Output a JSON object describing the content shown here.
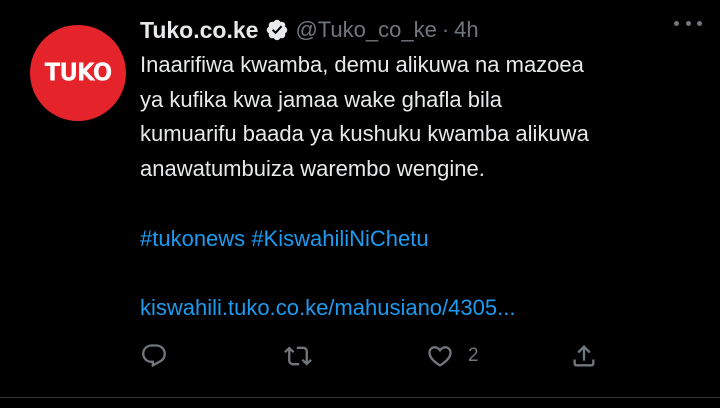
{
  "tweet": {
    "avatar_text": "TUKO",
    "display_name": "Tuko.co.ke",
    "handle": "@Tuko_co_ke",
    "separator": "·",
    "time": "4h",
    "body_lines": [
      "Inaarifiwa kwamba, demu alikuwa na mazoea",
      "ya kufika kwa jamaa wake ghafla bila",
      "kumuarifu baada ya kushuku kwamba alikuwa",
      "anawatumbuiza warembo wengine."
    ],
    "hashtags": [
      "#tukonews",
      "#KiswahiliNiChetu"
    ],
    "link": "kiswahili.tuko.co.ke/mahusiano/4305...",
    "actions": {
      "reply_count": "",
      "retweet_count": "",
      "like_count": "2"
    }
  },
  "icons": {
    "verified": "verified-badge-icon",
    "more": "more-horizontal-icon",
    "reply": "reply-icon",
    "retweet": "retweet-icon",
    "like": "heart-icon",
    "share": "share-icon"
  },
  "colors": {
    "background": "#000000",
    "text": "#e7e9ea",
    "secondary": "#71767b",
    "link": "#1d9bf0",
    "avatar": "#e4232a"
  }
}
